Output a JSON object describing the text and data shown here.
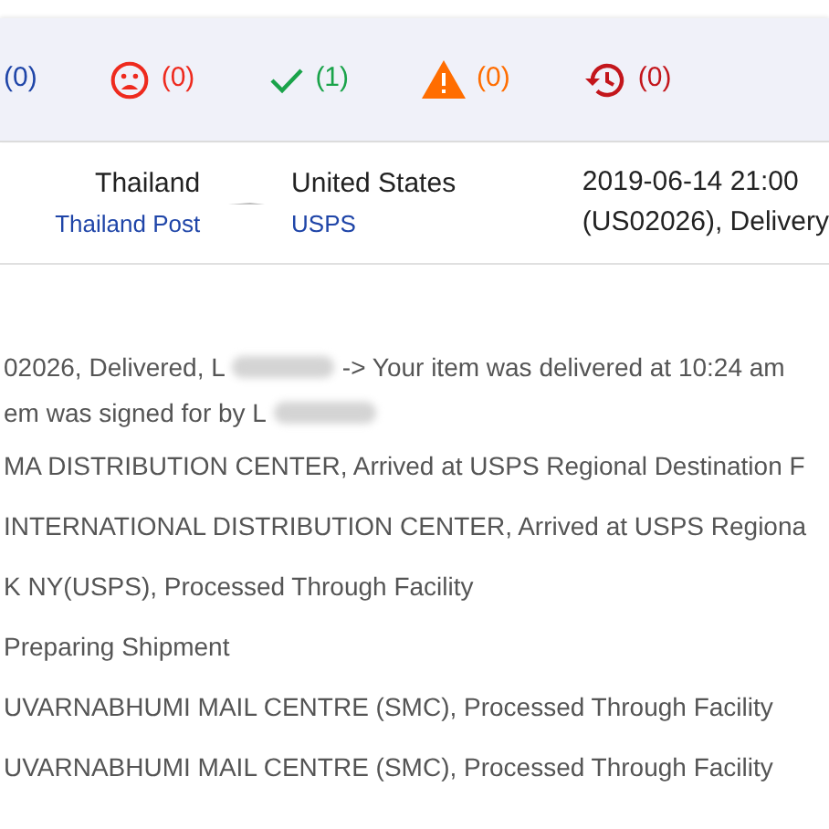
{
  "status_counts": [
    {
      "kind": "info",
      "count": "(0)",
      "color": "#1f45a8"
    },
    {
      "kind": "failed",
      "count": "(0)",
      "color": "#ee2a1e"
    },
    {
      "kind": "delivered",
      "count": "(1)",
      "color": "#1aa34a"
    },
    {
      "kind": "alert",
      "count": "(0)",
      "color": "#ff6d00"
    },
    {
      "kind": "expired",
      "count": "(0)",
      "color": "#c3161c"
    }
  ],
  "shipment": {
    "origin_country": "Thailand",
    "origin_carrier": "Thailand Post",
    "destination_country": "United States",
    "destination_carrier": "USPS",
    "latest_time": "2019-06-14 21:00",
    "latest_event": "(US02026), Delivery"
  },
  "events": [
    {
      "parts": [
        "02026, Delivered, L",
        "-> Your item was delivered at 10:24 am"
      ]
    },
    {
      "parts": [
        "em was signed for by L"
      ]
    },
    {
      "parts": [
        "MA DISTRIBUTION CENTER, Arrived at USPS Regional Destination F"
      ]
    },
    {
      "parts": [
        "INTERNATIONAL DISTRIBUTION CENTER, Arrived at USPS Regiona"
      ]
    },
    {
      "parts": [
        "K NY(USPS), Processed Through Facility"
      ]
    },
    {
      "parts": [
        "Preparing Shipment"
      ]
    },
    {
      "parts": [
        "UVARNABHUMI MAIL CENTRE (SMC), Processed Through Facility"
      ]
    },
    {
      "parts": [
        "UVARNABHUMI MAIL CENTRE (SMC), Processed Through Facility"
      ]
    }
  ]
}
